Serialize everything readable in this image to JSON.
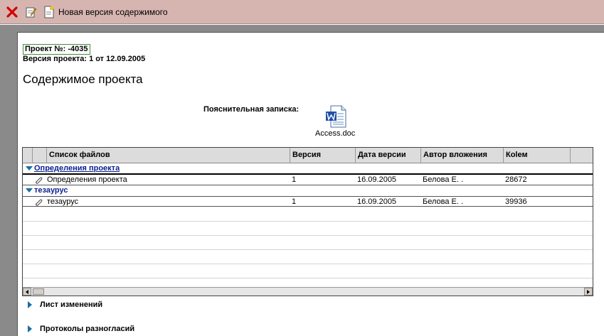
{
  "toolbar": {
    "new_version_label": "Новая версия содержимого"
  },
  "project": {
    "number_label": "Проект №: -4035",
    "version_label": "Версия проекта: 1 от 12.09.2005",
    "content_title": "Содержимое проекта"
  },
  "explanatory_note": {
    "label": "Пояснительная записка:",
    "file_name": "Access.doc"
  },
  "grid": {
    "columns": [
      "Список файлов",
      "Версия",
      "Дата версии",
      "Автор вложения",
      "Кolем"
    ],
    "groups": [
      {
        "title": "Определения проекта",
        "rows": [
          {
            "name": "Определения проекта",
            "version": "1",
            "date": "16.09.2005",
            "author": "Белова Е. .",
            "size": "28672"
          }
        ]
      },
      {
        "title": "тезаурус",
        "rows": [
          {
            "name": "тезаурус",
            "version": "1",
            "date": "16.09.2005",
            "author": "Белова Е. .",
            "size": "39936"
          }
        ]
      }
    ]
  },
  "sections": {
    "changes_sheet": "Лист изменений",
    "disagreement_protocols": "Протоколы разногласий"
  },
  "colors": {
    "toolbar_bg": "#d6b5b1",
    "group_text": "#0a1f8f",
    "expander": "#1a6fa0"
  }
}
